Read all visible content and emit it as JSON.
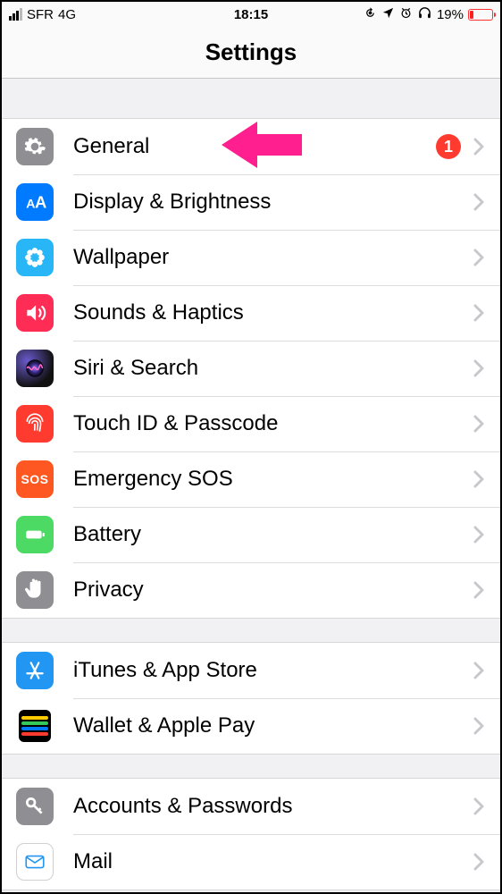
{
  "status": {
    "carrier": "SFR",
    "network": "4G",
    "time": "18:15",
    "battery_percent": "19%"
  },
  "page_title": "Settings",
  "groups": [
    {
      "rows": [
        {
          "icon": "gear-icon",
          "icon_bg": "bg-general",
          "label": "General",
          "badge": "1"
        },
        {
          "icon": "text-size-icon",
          "icon_bg": "bg-display",
          "label": "Display & Brightness"
        },
        {
          "icon": "flower-icon",
          "icon_bg": "bg-wallpaper",
          "label": "Wallpaper"
        },
        {
          "icon": "speaker-icon",
          "icon_bg": "bg-sounds",
          "label": "Sounds & Haptics"
        },
        {
          "icon": "siri-icon",
          "icon_bg": "bg-siri",
          "label": "Siri & Search"
        },
        {
          "icon": "fingerprint-icon",
          "icon_bg": "bg-touchid",
          "label": "Touch ID & Passcode"
        },
        {
          "icon": "sos-icon",
          "icon_bg": "bg-sos",
          "label": "Emergency SOS"
        },
        {
          "icon": "battery-icon",
          "icon_bg": "bg-battery",
          "label": "Battery"
        },
        {
          "icon": "hand-icon",
          "icon_bg": "bg-privacy",
          "label": "Privacy"
        }
      ]
    },
    {
      "rows": [
        {
          "icon": "appstore-icon",
          "icon_bg": "bg-itunes",
          "label": "iTunes & App Store"
        },
        {
          "icon": "wallet-icon",
          "icon_bg": "bg-wallet",
          "label": "Wallet & Apple Pay"
        }
      ]
    },
    {
      "rows": [
        {
          "icon": "key-icon",
          "icon_bg": "bg-accounts",
          "label": "Accounts & Passwords"
        },
        {
          "icon": "envelope-icon",
          "icon_bg": "bg-mail",
          "label": "Mail"
        }
      ]
    }
  ],
  "annotation": {
    "type": "pointer-arrow",
    "color": "#ff1f8f"
  }
}
